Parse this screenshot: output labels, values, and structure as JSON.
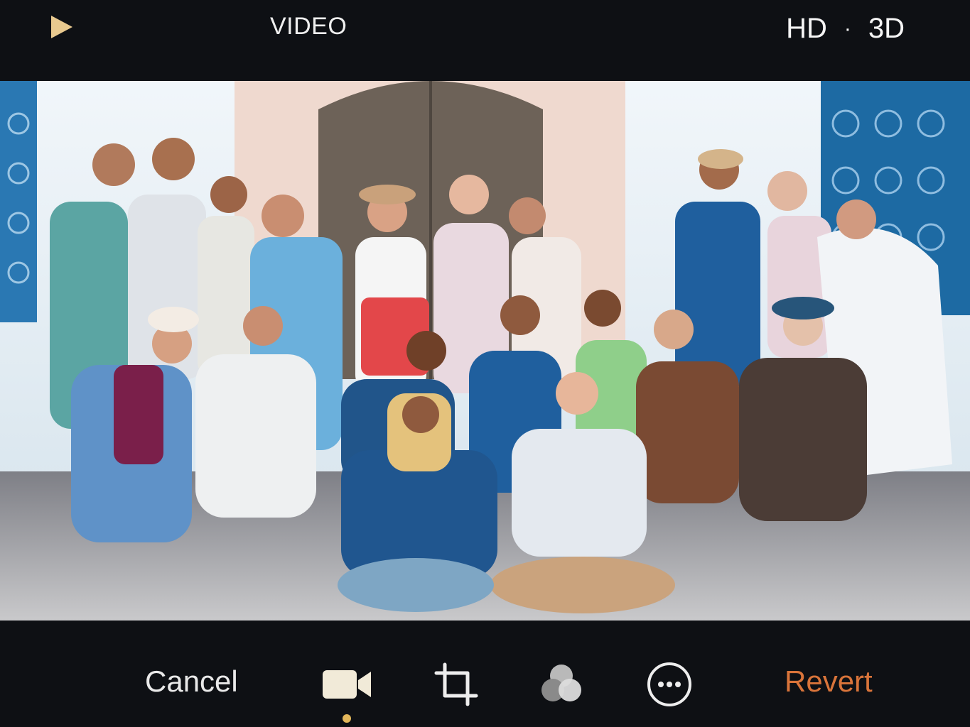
{
  "top_bar": {
    "mode_label": "VIDEO",
    "quality_hd": "HD",
    "separator": "·",
    "quality_3d": "3D",
    "play_icon": "play-icon",
    "play_color": "#e8c98f"
  },
  "photo": {
    "description_icon": "group-photo-image",
    "wall_color": "#e8f0f5",
    "door_color": "#6d6258",
    "window_color": "#1f6fa8"
  },
  "bottom_bar": {
    "cancel_label": "Cancel",
    "revert_label": "Revert",
    "revert_color": "#d9743a",
    "tools": [
      {
        "name": "video-camera-icon",
        "active": true
      },
      {
        "name": "crop-icon",
        "active": false
      },
      {
        "name": "filters-icon",
        "active": false
      },
      {
        "name": "more-options-icon",
        "active": false
      }
    ],
    "active_indicator_color": "#e2b65a"
  }
}
